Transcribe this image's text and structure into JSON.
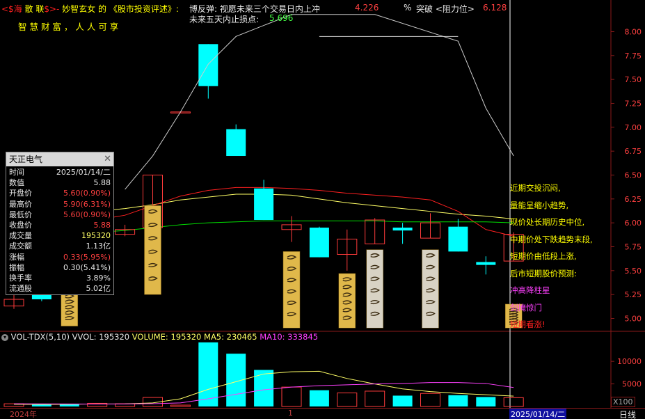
{
  "header": {
    "ticker_prefix": "<$海 ",
    "brand_mid": "散 联",
    "ticker_suffix": "$>-",
    "author": "妙智玄女",
    "of": "的",
    "book": "《股市投资评述》:",
    "rebound_label": "博反弹: 视愿未来三个交易日内上冲",
    "rebound_value": "4.226",
    "percent_sign": "%",
    "breakout_label": "突破 <阻力位>",
    "breakout_value": "6.128",
    "stoploss_label": "未来五天内止损点:",
    "stoploss_value": "5.696",
    "slogan": "智 慧 财 富 ， 人 人 可 享"
  },
  "colors": {
    "up": "#ff3b3b",
    "down": "#00ffff",
    "ma_short": "#ffff66",
    "ma_mid": "#ff2020",
    "ma_long": "#00dd00",
    "axis": "#8b1a1a",
    "magenta": "#ff40ff"
  },
  "info_panel": {
    "title": "天正电气",
    "rows": [
      {
        "label": "时间",
        "value": "2025/01/14/二",
        "color": "#e8e8e8"
      },
      {
        "label": "数值",
        "value": "5.88",
        "color": "#e8e8e8"
      },
      {
        "label": "开盘价",
        "value": "5.60(0.90%)",
        "color": "#ff4040"
      },
      {
        "label": "最高价",
        "value": "5.90(6.31%)",
        "color": "#ff4040"
      },
      {
        "label": "最低价",
        "value": "5.60(0.90%)",
        "color": "#ff4040"
      },
      {
        "label": "收盘价",
        "value": "5.88",
        "color": "#ff4040"
      },
      {
        "label": "成交量",
        "value": "195320",
        "color": "#ffff66"
      },
      {
        "label": "成交额",
        "value": "1.13亿",
        "color": "#e8e8e8"
      },
      {
        "label": "涨幅",
        "value": "0.33(5.95%)",
        "color": "#ff4040"
      },
      {
        "label": "振幅",
        "value": "0.30(5.41%)",
        "color": "#e8e8e8"
      },
      {
        "label": "换手率",
        "value": "3.89%",
        "color": "#e8e8e8"
      },
      {
        "label": "流通股",
        "value": "5.02亿",
        "color": "#e8e8e8"
      }
    ]
  },
  "commentary": [
    {
      "text": "近期交投沉闷,",
      "color": "#ffff00"
    },
    {
      "text": "量能呈缩小趋势,",
      "color": "#ffff00"
    },
    {
      "text": "现价处长期历史中位,",
      "color": "#ffff00"
    },
    {
      "text": "中期价处下跌趋势末段,",
      "color": "#ffff00"
    },
    {
      "text": "短期价由低段上涨,",
      "color": "#ffff00"
    },
    {
      "text": "后市短期股价预测:",
      "color": "#ffff00"
    },
    {
      "text": "冲高降柱星",
      "color": "#ff40ff"
    },
    {
      "text": "剑掩惊门",
      "color": "#ff40ff"
    },
    {
      "text": "短期看涨!",
      "color": "#ff2020"
    }
  ],
  "volume_panel": {
    "indicator": "VOL-TDX(5,10)",
    "vvol_label": "VVOL:",
    "vvol_value": "195320",
    "volume_label": "VOLUME:",
    "volume_value": "195320",
    "ma5_label": "MA5:",
    "ma5_value": "230465",
    "ma10_label": "MA10:",
    "ma10_value": "333845",
    "multiplier": "X100"
  },
  "price_axis_ticks": [
    "8.00",
    "7.75",
    "7.50",
    "7.25",
    "7.00",
    "6.75",
    "6.50",
    "6.25",
    "6.00",
    "5.75",
    "5.50",
    "5.25",
    "5.00"
  ],
  "volume_axis_ticks": [
    "10000",
    "5000"
  ],
  "status_bar": {
    "year_label": "2024年",
    "month_mark": "1",
    "date_label": "2025/01/14/二",
    "period_label": "日线"
  },
  "chart_data": {
    "type": "candlestick",
    "price_ylim": [
      4.88,
      8.2
    ],
    "volume_ylim": [
      0,
      14500
    ],
    "candles": [
      {
        "open": 5.13,
        "close": 5.2,
        "high": 5.25,
        "low": 5.1,
        "vol": 600
      },
      {
        "open": 5.25,
        "close": 5.2,
        "high": 5.28,
        "low": 5.18,
        "vol": 400
      },
      {
        "open": 6.05,
        "close": 6.04,
        "high": 6.08,
        "low": 6.0,
        "vol": 500
      },
      {
        "open": 5.95,
        "close": 5.98,
        "high": 6.04,
        "low": 5.93,
        "vol": 700
      },
      {
        "open": 5.88,
        "close": 5.93,
        "high": 5.98,
        "low": 5.86,
        "vol": 600
      },
      {
        "open": 5.95,
        "close": 6.5,
        "high": 6.5,
        "low": 5.93,
        "vol": 2000
      },
      {
        "open": 7.15,
        "close": 7.16,
        "high": 7.16,
        "low": 7.15,
        "vol": 300
      },
      {
        "open": 7.87,
        "close": 7.43,
        "high": 7.87,
        "low": 7.3,
        "vol": 14200
      },
      {
        "open": 6.98,
        "close": 6.7,
        "high": 7.03,
        "low": 6.7,
        "vol": 11700
      },
      {
        "open": 6.36,
        "close": 6.03,
        "high": 6.45,
        "low": 6.03,
        "vol": 8100
      },
      {
        "open": 5.93,
        "close": 5.98,
        "high": 6.07,
        "low": 5.8,
        "vol": 4300
      },
      {
        "open": 5.95,
        "close": 5.64,
        "high": 5.96,
        "low": 5.64,
        "vol": 3600
      },
      {
        "open": 5.67,
        "close": 5.83,
        "high": 5.93,
        "low": 5.5,
        "vol": 3000
      },
      {
        "open": 5.78,
        "close": 6.03,
        "high": 6.05,
        "low": 5.78,
        "vol": 3400
      },
      {
        "open": 5.95,
        "close": 5.92,
        "high": 6.0,
        "low": 5.78,
        "vol": 2400
      },
      {
        "open": 5.84,
        "close": 6.0,
        "high": 6.1,
        "low": 5.84,
        "vol": 2900
      },
      {
        "open": 5.96,
        "close": 5.7,
        "high": 6.04,
        "low": 5.7,
        "vol": 2500
      },
      {
        "open": 5.59,
        "close": 5.56,
        "high": 5.65,
        "low": 5.46,
        "vol": 2100
      },
      {
        "open": 5.6,
        "close": 5.88,
        "high": 5.9,
        "low": 5.6,
        "vol": 1953
      }
    ],
    "ma_price": [
      {
        "name": "ma_short",
        "values": [
          6.08,
          6.1,
          6.11,
          6.12,
          6.15,
          6.19,
          6.24,
          6.27,
          6.3,
          6.3,
          6.29,
          6.25,
          6.21,
          6.18,
          6.15,
          6.12,
          6.09,
          6.07,
          6.04
        ]
      },
      {
        "name": "ma_mid",
        "values": [
          5.95,
          5.96,
          5.98,
          6.03,
          6.08,
          6.18,
          6.28,
          6.34,
          6.37,
          6.37,
          6.36,
          6.34,
          6.31,
          6.29,
          6.27,
          6.24,
          6.12,
          5.93,
          5.86
        ]
      },
      {
        "name": "ma_long",
        "values": [
          5.84,
          5.86,
          5.88,
          5.9,
          5.92,
          5.95,
          5.98,
          6.0,
          6.01,
          6.02,
          6.02,
          6.02,
          6.02,
          6.02,
          6.01,
          6.01,
          6.01,
          6.01,
          6.0
        ]
      }
    ],
    "ma_volume": [
      {
        "name": "MA5",
        "values": [
          480,
          460,
          480,
          560,
          580,
          800,
          1700,
          3800,
          5500,
          7200,
          7700,
          7800,
          6200,
          5000,
          3900,
          3300,
          2900,
          2600,
          2300
        ]
      },
      {
        "name": "MA10",
        "values": [
          600,
          570,
          550,
          540,
          560,
          620,
          800,
          1700,
          2700,
          3700,
          4300,
          4600,
          4800,
          5000,
          5100,
          5300,
          5300,
          5100,
          4200
        ]
      }
    ],
    "trend_line": [
      {
        "i": 4,
        "price": 6.35
      },
      {
        "i": 5,
        "price": 6.7
      },
      {
        "i": 6,
        "price": 7.16
      },
      {
        "i": 7,
        "price": 7.66
      },
      {
        "i": 8,
        "price": 7.95
      },
      {
        "i": 10,
        "price": 8.18
      },
      {
        "i": 13,
        "price": 8.18
      },
      {
        "i": 16,
        "price": 7.9
      },
      {
        "i": 17,
        "price": 7.2
      },
      {
        "i": 18,
        "price": 6.7
      }
    ],
    "resistance_line": {
      "from_i": 11,
      "to_i": 16,
      "price": 7.95
    }
  }
}
